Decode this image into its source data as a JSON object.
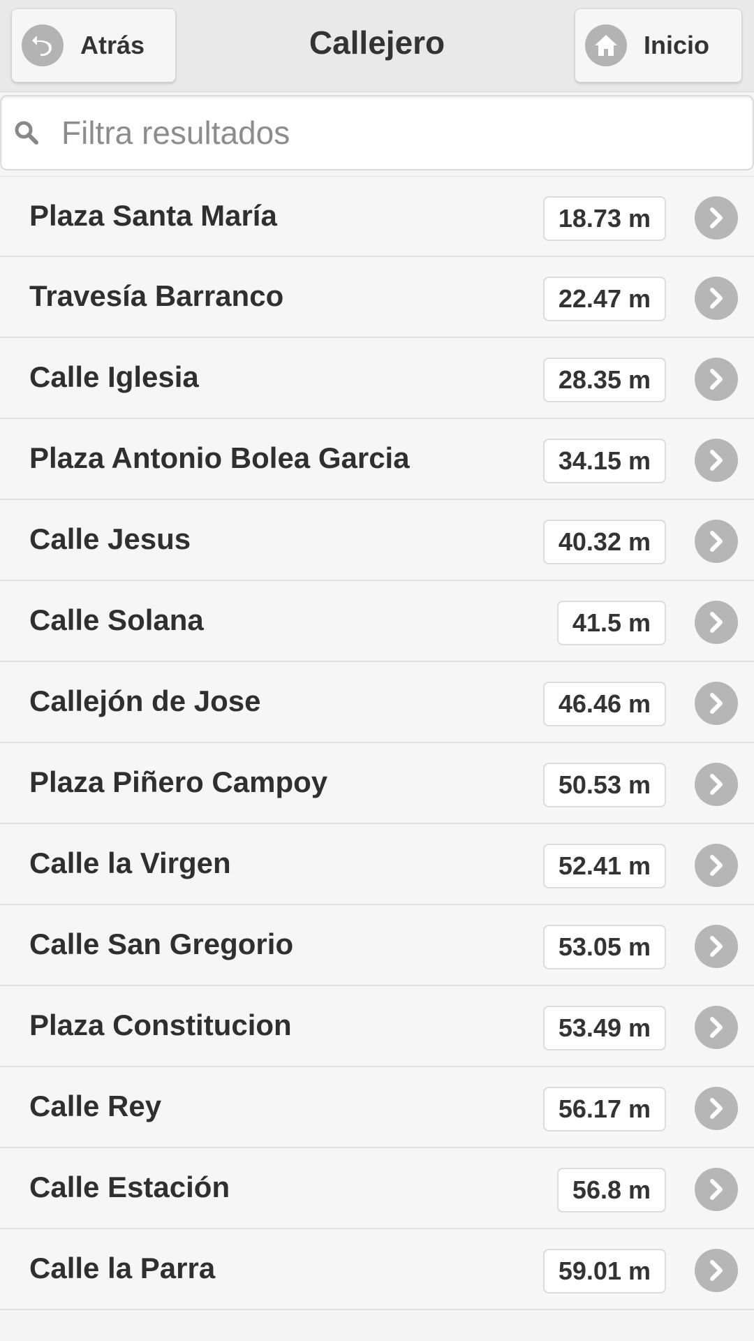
{
  "header": {
    "back_label": "Atrás",
    "title": "Callejero",
    "home_label": "Inicio"
  },
  "search": {
    "placeholder": "Filtra resultados",
    "value": ""
  },
  "streets": [
    {
      "name": "Plaza Santa María",
      "distance": "18.73 m"
    },
    {
      "name": "Travesía Barranco",
      "distance": "22.47 m"
    },
    {
      "name": "Calle Iglesia",
      "distance": "28.35 m"
    },
    {
      "name": "Plaza Antonio Bolea Garcia",
      "distance": "34.15 m"
    },
    {
      "name": "Calle Jesus",
      "distance": "40.32 m"
    },
    {
      "name": "Calle Solana",
      "distance": "41.5 m"
    },
    {
      "name": "Callejón de Jose",
      "distance": "46.46 m"
    },
    {
      "name": "Plaza Piñero Campoy",
      "distance": "50.53 m"
    },
    {
      "name": "Calle la Virgen",
      "distance": "52.41 m"
    },
    {
      "name": "Calle San Gregorio",
      "distance": "53.05 m"
    },
    {
      "name": "Plaza Constitucion",
      "distance": "53.49 m"
    },
    {
      "name": "Calle Rey",
      "distance": "56.17 m"
    },
    {
      "name": "Calle Estación",
      "distance": "56.8 m"
    },
    {
      "name": "Calle la Parra",
      "distance": "59.01 m"
    }
  ],
  "icons": {
    "back": "back-arrow-icon",
    "home": "home-icon",
    "search": "search-icon",
    "row_action": "chevron-right-icon"
  },
  "colors": {
    "header_bg": "#e9e9e9",
    "list_bg": "#f6f6f6",
    "icon_circle": "#b6b6b6",
    "text": "#333333"
  }
}
